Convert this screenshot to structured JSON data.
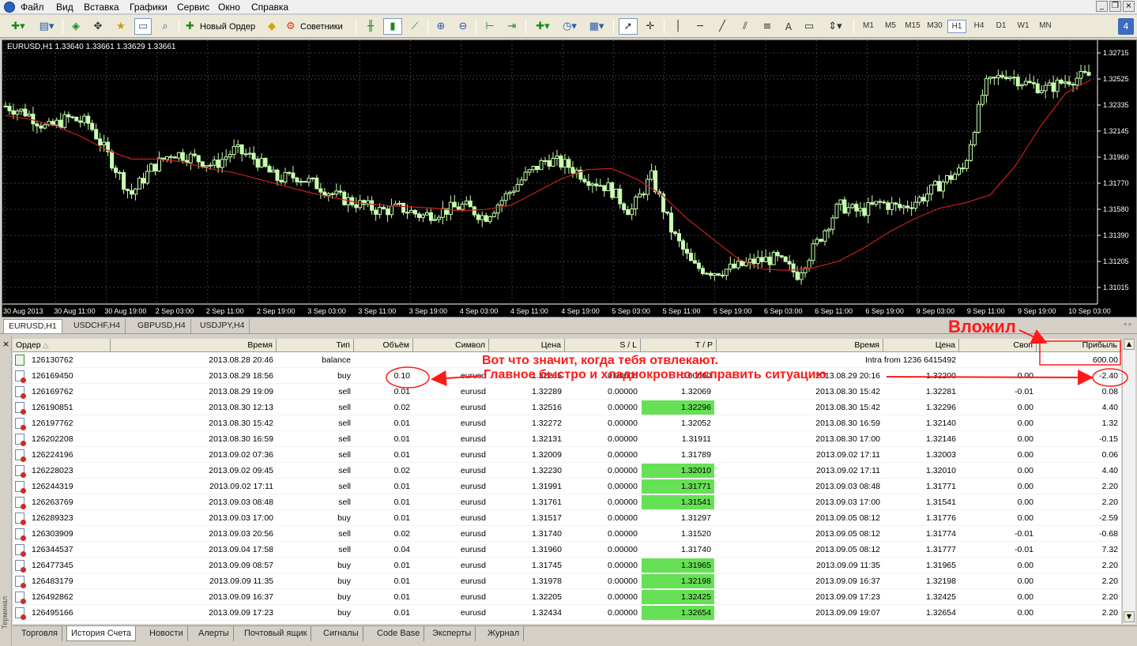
{
  "menu": [
    "Файл",
    "Вид",
    "Вставка",
    "Графики",
    "Сервис",
    "Окно",
    "Справка"
  ],
  "toolbar": {
    "new_order_label": "Новый Ордер",
    "advisors_label": "Советники",
    "timeframes": [
      "M1",
      "M5",
      "M15",
      "M30",
      "H1",
      "H4",
      "D1",
      "W1",
      "MN"
    ],
    "active_timeframe": "H1"
  },
  "chart": {
    "header": "EURUSD,H1  1.33640 1.33661 1.33629 1.33661",
    "price_ticks": [
      "1.32715",
      "1.32525",
      "1.32335",
      "1.32145",
      "1.31960",
      "1.31770",
      "1.31580",
      "1.31390",
      "1.31205",
      "1.31015"
    ],
    "time_ticks": [
      "30 Aug 2013",
      "30 Aug 11:00",
      "30 Aug 19:00",
      "2 Sep 03:00",
      "2 Sep 11:00",
      "2 Sep 19:00",
      "3 Sep 03:00",
      "3 Sep 11:00",
      "3 Sep 19:00",
      "4 Sep 03:00",
      "4 Sep 11:00",
      "4 Sep 19:00",
      "5 Sep 03:00",
      "5 Sep 11:00",
      "5 Sep 19:00",
      "6 Sep 03:00",
      "6 Sep 11:00",
      "6 Sep 19:00",
      "9 Sep 03:00",
      "9 Sep 11:00",
      "9 Sep 19:00",
      "10 Sep 03:00"
    ],
    "colors": {
      "background": "#000000",
      "candle": "#c8ffb0",
      "ma": "#c81e1e",
      "grid": "#3a3a3a"
    }
  },
  "chart_data": {
    "type": "candlestick",
    "symbol": "EURUSD",
    "timeframe": "H1",
    "ylim": [
      1.3098,
      1.3284
    ],
    "close_path": [
      1.3245,
      1.324,
      1.3228,
      1.3236,
      1.3232,
      1.3206,
      1.3178,
      1.3198,
      1.321,
      1.3206,
      1.32,
      1.3212,
      1.3205,
      1.319,
      1.3192,
      1.3185,
      1.3176,
      1.3171,
      1.3166,
      1.3168,
      1.3162,
      1.3166,
      1.317,
      1.3161,
      1.3177,
      1.3193,
      1.3205,
      1.32,
      1.319,
      1.3183,
      1.3165,
      1.3192,
      1.315,
      1.3124,
      1.312,
      1.3123,
      1.3128,
      1.313,
      1.3118,
      1.3143,
      1.317,
      1.3165,
      1.3172,
      1.3168,
      1.3176,
      1.3188,
      1.3198,
      1.326,
      1.327,
      1.3262,
      1.3258,
      1.3265,
      1.3268
    ],
    "ma_path": [
      1.3238,
      1.3235,
      1.323,
      1.3222,
      1.3212,
      1.3205,
      1.3205,
      1.3203,
      1.3198,
      1.3195,
      1.319,
      1.3185,
      1.318,
      1.3176,
      1.3172,
      1.317,
      1.3169,
      1.3168,
      1.3166,
      1.3167,
      1.317,
      1.318,
      1.319,
      1.3197,
      1.3198,
      1.319,
      1.3178,
      1.316,
      1.3145,
      1.313,
      1.3122,
      1.3121,
      1.3123,
      1.3128,
      1.3138,
      1.315,
      1.316,
      1.3168,
      1.3172,
      1.3178,
      1.32,
      1.323,
      1.3255,
      1.3265
    ]
  },
  "chart_tabs": [
    "EURUSD,H1",
    "USDCHF,H4",
    "GBPUSD,H4",
    "USDJPY,H4"
  ],
  "table": {
    "headers": {
      "order": "Ордер",
      "time": "Время",
      "type": "Тип",
      "volume": "Объём",
      "symbol": "Символ",
      "price": "Цена",
      "sl": "S / L",
      "tp": "T / P",
      "close_time": "Время",
      "close_price": "Цена",
      "swap": "Своп",
      "profit": "Прибыль"
    },
    "balance_row": {
      "order": "126130762",
      "time": "2013.08.28 20:46",
      "type": "balance",
      "comment": "Intra from 1236 6415492",
      "profit": "600.00"
    },
    "rows": [
      {
        "order": "126169450",
        "time": "2013.08.29 18:56",
        "type": "buy",
        "volume": "0.10",
        "symbol": "eurusd",
        "price": "1.32265",
        "sl": "0.00000",
        "tp": "0.00000",
        "close_time": "2013.08.29 20:16",
        "close_price": "1.32200",
        "swap": "0.00",
        "profit": "-2.40",
        "tp_hit": false
      },
      {
        "order": "126169762",
        "time": "2013.08.29 19:09",
        "type": "sell",
        "volume": "0.01",
        "symbol": "eurusd",
        "price": "1.32289",
        "sl": "0.00000",
        "tp": "1.32069",
        "close_time": "2013.08.30 15:42",
        "close_price": "1.32281",
        "swap": "-0.01",
        "profit": "0.08",
        "tp_hit": false
      },
      {
        "order": "126190851",
        "time": "2013.08.30 12:13",
        "type": "sell",
        "volume": "0.02",
        "symbol": "eurusd",
        "price": "1.32516",
        "sl": "0.00000",
        "tp": "1.32296",
        "close_time": "2013.08.30 15:42",
        "close_price": "1.32296",
        "swap": "0.00",
        "profit": "4.40",
        "tp_hit": true
      },
      {
        "order": "126197762",
        "time": "2013.08.30 15:42",
        "type": "sell",
        "volume": "0.01",
        "symbol": "eurusd",
        "price": "1.32272",
        "sl": "0.00000",
        "tp": "1.32052",
        "close_time": "2013.08.30 16:59",
        "close_price": "1.32140",
        "swap": "0.00",
        "profit": "1.32",
        "tp_hit": false
      },
      {
        "order": "126202208",
        "time": "2013.08.30 16:59",
        "type": "sell",
        "volume": "0.01",
        "symbol": "eurusd",
        "price": "1.32131",
        "sl": "0.00000",
        "tp": "1.31911",
        "close_time": "2013.08.30 17:00",
        "close_price": "1.32146",
        "swap": "0.00",
        "profit": "-0.15",
        "tp_hit": false
      },
      {
        "order": "126224196",
        "time": "2013.09.02 07:36",
        "type": "sell",
        "volume": "0.01",
        "symbol": "eurusd",
        "price": "1.32009",
        "sl": "0.00000",
        "tp": "1.31789",
        "close_time": "2013.09.02 17:11",
        "close_price": "1.32003",
        "swap": "0.00",
        "profit": "0.06",
        "tp_hit": false
      },
      {
        "order": "126228023",
        "time": "2013.09.02 09:45",
        "type": "sell",
        "volume": "0.02",
        "symbol": "eurusd",
        "price": "1.32230",
        "sl": "0.00000",
        "tp": "1.32010",
        "close_time": "2013.09.02 17:11",
        "close_price": "1.32010",
        "swap": "0.00",
        "profit": "4.40",
        "tp_hit": true
      },
      {
        "order": "126244319",
        "time": "2013.09.02 17:11",
        "type": "sell",
        "volume": "0.01",
        "symbol": "eurusd",
        "price": "1.31991",
        "sl": "0.00000",
        "tp": "1.31771",
        "close_time": "2013.09.03 08:48",
        "close_price": "1.31771",
        "swap": "0.00",
        "profit": "2.20",
        "tp_hit": true
      },
      {
        "order": "126263769",
        "time": "2013.09.03 08:48",
        "type": "sell",
        "volume": "0.01",
        "symbol": "eurusd",
        "price": "1.31761",
        "sl": "0.00000",
        "tp": "1.31541",
        "close_time": "2013.09.03 17:00",
        "close_price": "1.31541",
        "swap": "0.00",
        "profit": "2.20",
        "tp_hit": true
      },
      {
        "order": "126289323",
        "time": "2013.09.03 17:00",
        "type": "buy",
        "volume": "0.01",
        "symbol": "eurusd",
        "price": "1.31517",
        "sl": "0.00000",
        "tp": "1.31297",
        "close_time": "2013.09.05 08:12",
        "close_price": "1.31776",
        "swap": "0.00",
        "profit": "-2.59",
        "tp_hit": false
      },
      {
        "order": "126303909",
        "time": "2013.09.03 20:56",
        "type": "sell",
        "volume": "0.02",
        "symbol": "eurusd",
        "price": "1.31740",
        "sl": "0.00000",
        "tp": "1.31520",
        "close_time": "2013.09.05 08:12",
        "close_price": "1.31774",
        "swap": "-0.01",
        "profit": "-0.68",
        "tp_hit": false
      },
      {
        "order": "126344537",
        "time": "2013.09.04 17:58",
        "type": "sell",
        "volume": "0.04",
        "symbol": "eurusd",
        "price": "1.31960",
        "sl": "0.00000",
        "tp": "1.31740",
        "close_time": "2013.09.05 08:12",
        "close_price": "1.31777",
        "swap": "-0.01",
        "profit": "7.32",
        "tp_hit": false
      },
      {
        "order": "126477345",
        "time": "2013.09.09 08:57",
        "type": "buy",
        "volume": "0.01",
        "symbol": "eurusd",
        "price": "1.31745",
        "sl": "0.00000",
        "tp": "1.31965",
        "close_time": "2013.09.09 11:35",
        "close_price": "1.31965",
        "swap": "0.00",
        "profit": "2.20",
        "tp_hit": true
      },
      {
        "order": "126483179",
        "time": "2013.09.09 11:35",
        "type": "buy",
        "volume": "0.01",
        "symbol": "eurusd",
        "price": "1.31978",
        "sl": "0.00000",
        "tp": "1.32198",
        "close_time": "2013.09.09 16:37",
        "close_price": "1.32198",
        "swap": "0.00",
        "profit": "2.20",
        "tp_hit": true
      },
      {
        "order": "126492862",
        "time": "2013.09.09 16:37",
        "type": "buy",
        "volume": "0.01",
        "symbol": "eurusd",
        "price": "1.32205",
        "sl": "0.00000",
        "tp": "1.32425",
        "close_time": "2013.09.09 17:23",
        "close_price": "1.32425",
        "swap": "0.00",
        "profit": "2.20",
        "tp_hit": true
      },
      {
        "order": "126495166",
        "time": "2013.09.09 17:23",
        "type": "buy",
        "volume": "0.01",
        "symbol": "eurusd",
        "price": "1.32434",
        "sl": "0.00000",
        "tp": "1.32654",
        "close_time": "2013.09.09 19:07",
        "close_price": "1.32654",
        "swap": "0.00",
        "profit": "2.20",
        "tp_hit": true
      }
    ]
  },
  "terminal": {
    "close_symbol": "×",
    "vertical_label": "Терминал"
  },
  "bottom_tabs": [
    "Торговля",
    "История Счета",
    "Новости",
    "Алерты",
    "Почтовый ящик",
    "Сигналы",
    "Code Base",
    "Эксперты",
    "Журнал"
  ],
  "active_bottom_tab": "История Счета",
  "annotations": {
    "title": "Вложил",
    "line1": "Вот что значит,  когда тебя отвлекают.",
    "line2": "Главное быстро и хладнокровно  исправить ситуацию",
    "color": "#ff1a1a"
  }
}
